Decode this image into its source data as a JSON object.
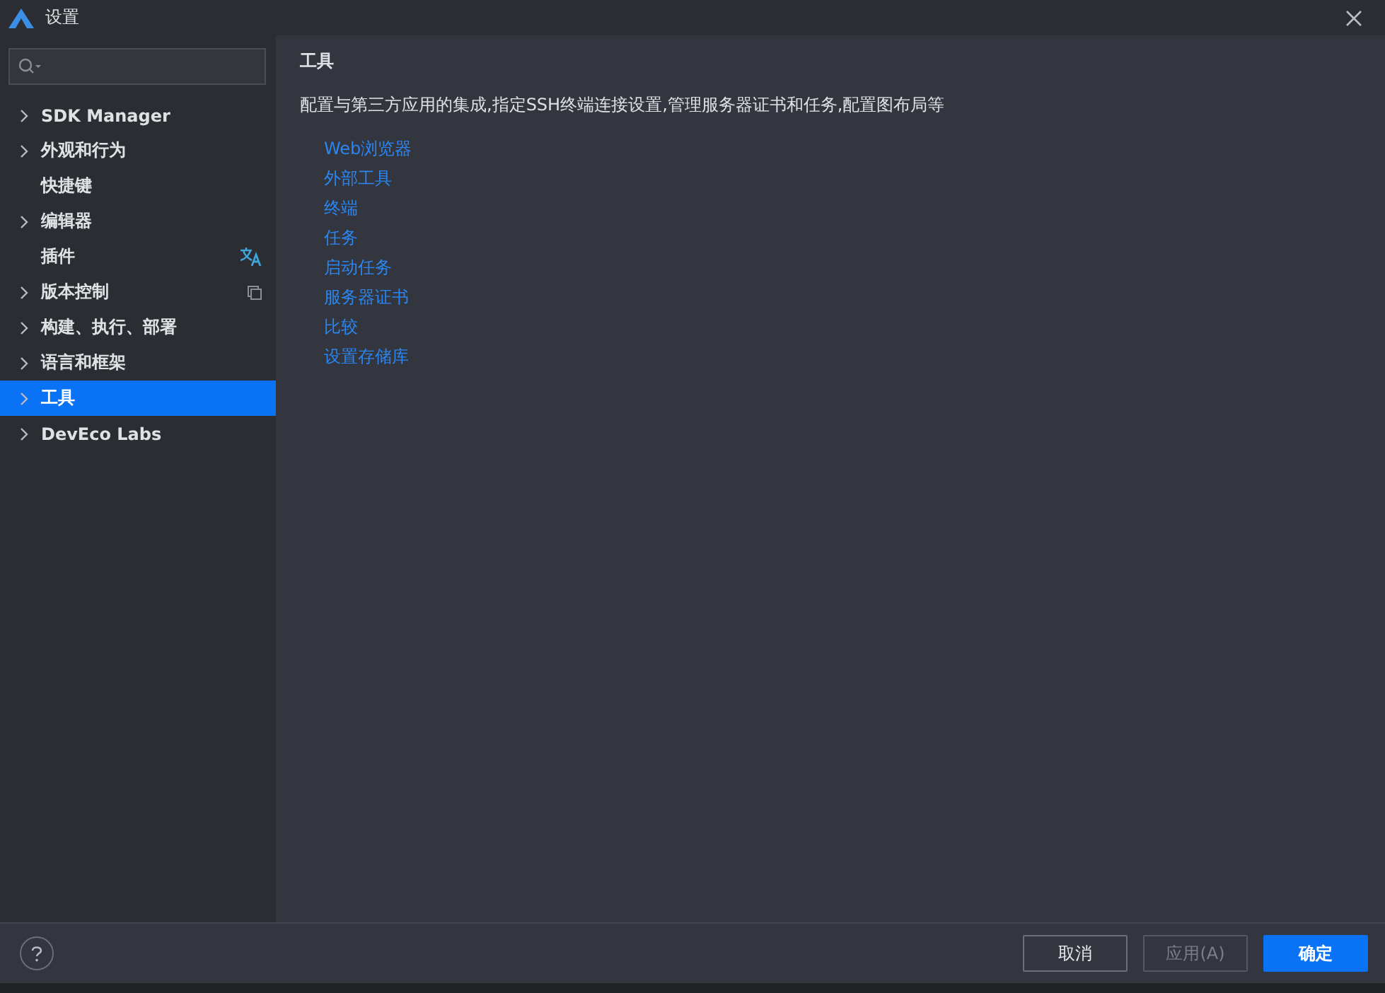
{
  "window": {
    "title": "设置"
  },
  "sidebar": {
    "items": [
      {
        "label": "SDK Manager",
        "expandable": true,
        "selected": false,
        "kind": "plain"
      },
      {
        "label": "外观和行为",
        "expandable": true,
        "selected": false,
        "kind": "plain"
      },
      {
        "label": "快捷键",
        "expandable": false,
        "selected": false,
        "kind": "plain"
      },
      {
        "label": "编辑器",
        "expandable": true,
        "selected": false,
        "kind": "plain"
      },
      {
        "label": "插件",
        "expandable": false,
        "selected": false,
        "kind": "translate"
      },
      {
        "label": "版本控制",
        "expandable": true,
        "selected": false,
        "kind": "copy"
      },
      {
        "label": "构建、执行、部署",
        "expandable": true,
        "selected": false,
        "kind": "plain"
      },
      {
        "label": "语言和框架",
        "expandable": true,
        "selected": false,
        "kind": "plain"
      },
      {
        "label": "工具",
        "expandable": true,
        "selected": true,
        "kind": "plain"
      },
      {
        "label": "DevEco Labs",
        "expandable": true,
        "selected": false,
        "kind": "plain"
      }
    ]
  },
  "content": {
    "heading": "工具",
    "description": "配置与第三方应用的集成,指定SSH终端连接设置,管理服务器证书和任务,配置图布局等",
    "links": [
      "Web浏览器",
      "外部工具",
      "终端",
      "任务",
      "启动任务",
      "服务器证书",
      "比较",
      "设置存储库"
    ]
  },
  "buttons": [
    {
      "label": "取消",
      "kind": "secondary",
      "disabled": false
    },
    {
      "label": "应用(A)",
      "kind": "secondary",
      "disabled": true
    },
    {
      "label": "确定",
      "kind": "primary",
      "disabled": false
    }
  ]
}
